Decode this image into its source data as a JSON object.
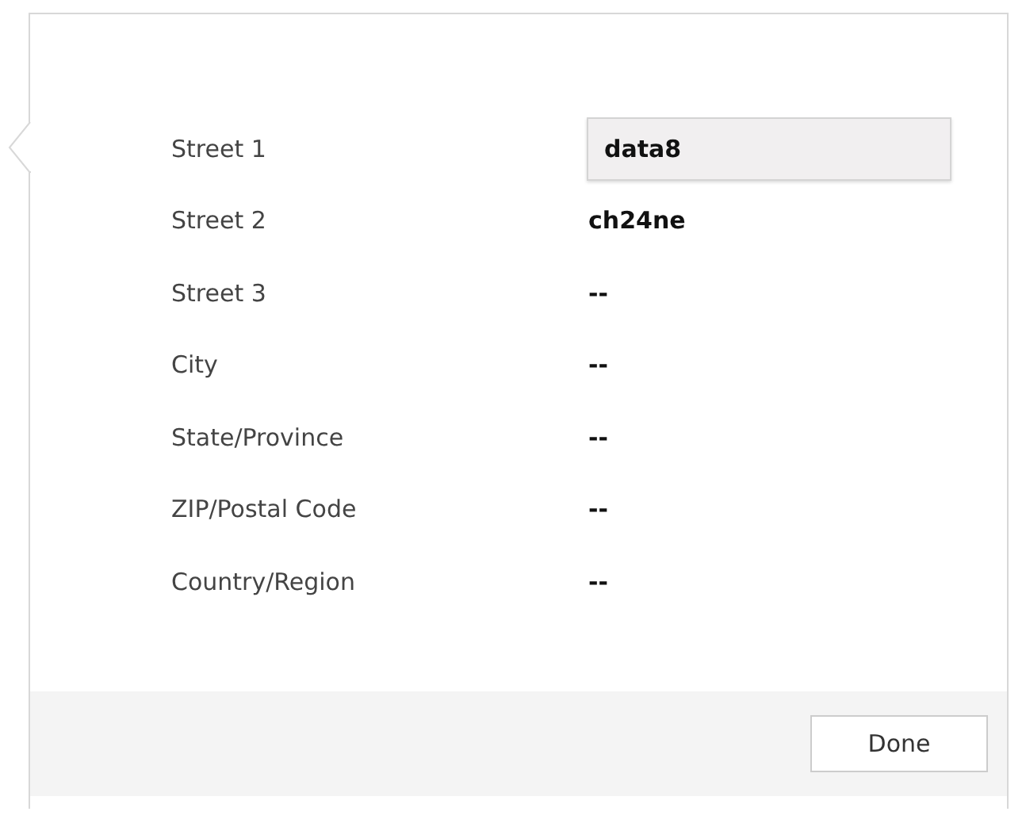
{
  "fields": [
    {
      "label": "Street 1",
      "kind": "input",
      "value": "data8"
    },
    {
      "label": "Street 2",
      "kind": "text",
      "value": "ch24ne"
    },
    {
      "label": "Street 3",
      "kind": "text",
      "value": "--"
    },
    {
      "label": "City",
      "kind": "text",
      "value": "--"
    },
    {
      "label": "State/Province",
      "kind": "text",
      "value": "--"
    },
    {
      "label": "ZIP/Postal Code",
      "kind": "text",
      "value": "--"
    },
    {
      "label": "Country/Region",
      "kind": "text",
      "value": "--"
    }
  ],
  "buttons": [
    "Done"
  ]
}
